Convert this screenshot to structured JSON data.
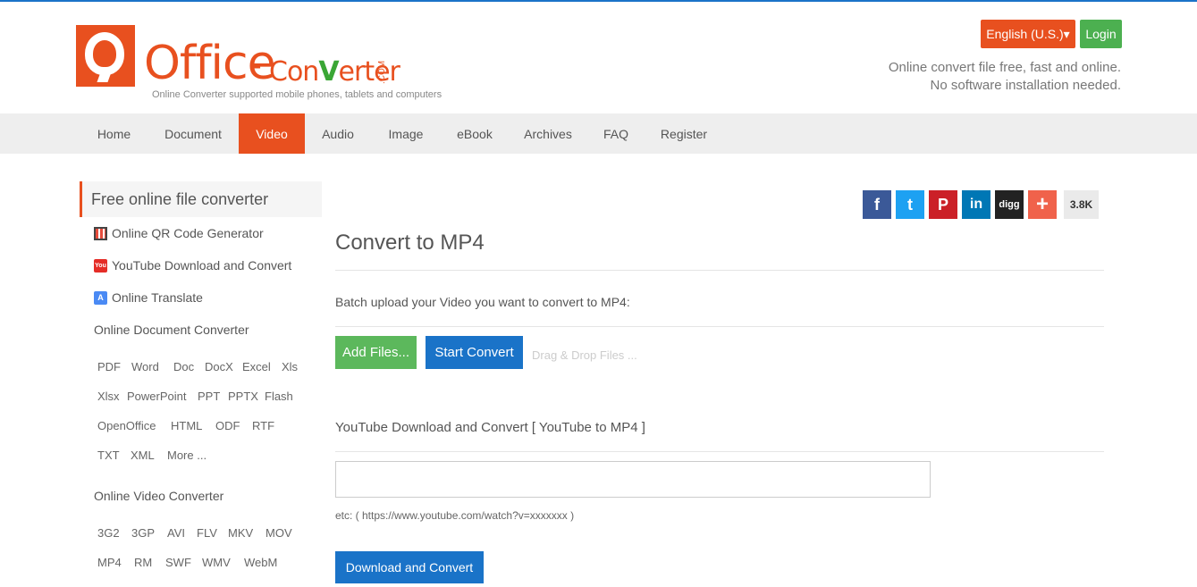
{
  "header": {
    "logo_main": "Office",
    "logo_dash": "-",
    "logo_conv_a": "Con",
    "logo_conv_v": "V",
    "logo_conv_b": "erter",
    "logo_com": ".COM",
    "logo_sub": "Online Converter supported mobile phones, tablets and computers",
    "lang_label": "English (U.S.)▾",
    "login_label": "Login",
    "tagline_1": "Online convert file free, fast and online.",
    "tagline_2": "No software installation needed."
  },
  "nav": {
    "items": [
      {
        "label": "Home"
      },
      {
        "label": "Document"
      },
      {
        "label": "Video"
      },
      {
        "label": "Audio"
      },
      {
        "label": "Image"
      },
      {
        "label": "eBook"
      },
      {
        "label": "Archives"
      },
      {
        "label": "FAQ"
      },
      {
        "label": "Register"
      }
    ],
    "active": "Video"
  },
  "sidebar": {
    "title": "Free online file converter",
    "links": [
      {
        "label": "Online QR Code Generator",
        "icon": "qr-code-icon"
      },
      {
        "label": "YouTube Download and Convert",
        "icon": "youtube-icon"
      },
      {
        "label": "Online Translate",
        "icon": "translate-icon"
      }
    ],
    "yt_icon_text": "You",
    "tr_icon_text": "A",
    "doc_section": "Online Document Converter",
    "doc_formats": [
      "PDF",
      "Word",
      "Doc",
      "DocX",
      "Excel",
      "Xls",
      "Xlsx",
      "PowerPoint",
      "PPT",
      "PPTX",
      "Flash",
      "OpenOffice",
      "HTML",
      "ODF",
      "RTF",
      "TXT",
      "XML",
      "More ..."
    ],
    "video_section": "Online Video Converter",
    "video_formats": [
      "3G2",
      "3GP",
      "AVI",
      "FLV",
      "MKV",
      "MOV",
      "MP4",
      "RM",
      "SWF",
      "WMV",
      "WebM"
    ]
  },
  "social": {
    "buttons": [
      {
        "label": "f",
        "icon": "facebook-icon",
        "color": "#3b5998"
      },
      {
        "label": "t",
        "icon": "twitter-icon",
        "color": "#1da1f2"
      },
      {
        "label": "P",
        "icon": "pinterest-icon",
        "color": "#cb2027"
      },
      {
        "label": "in",
        "icon": "linkedin-icon",
        "color": "#0077b5"
      },
      {
        "label": "digg",
        "icon": "digg-icon",
        "color": "#222222"
      },
      {
        "label": "+",
        "icon": "plus-icon",
        "color": "#f0624b"
      }
    ],
    "count": "3.8K"
  },
  "main": {
    "title": "Convert to MP4",
    "batch_text": "Batch upload your Video you want to convert to MP4:",
    "add_files": "Add Files...",
    "start_convert": "Start Convert",
    "drag_drop": "Drag & Drop Files ...",
    "yt_title": "YouTube Download and Convert [ YouTube to MP4 ]",
    "url_value": "",
    "etc_text": "etc: ( https://www.youtube.com/watch?v=xxxxxxx )",
    "download_convert": "Download and Convert"
  },
  "colors": {
    "brand": "#e8501f",
    "green": "#4cb050",
    "blue": "#1a73c8"
  }
}
